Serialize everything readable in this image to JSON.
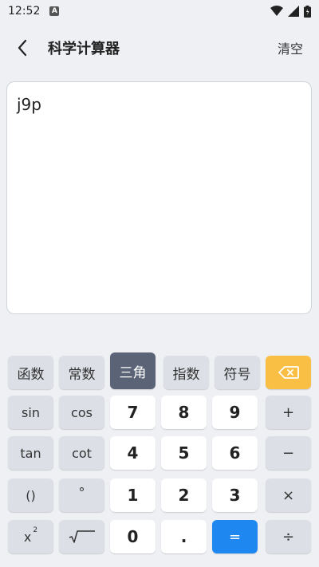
{
  "status": {
    "time": "12:52",
    "a_icon_letter": "A"
  },
  "header": {
    "title": "科学计算器",
    "clear_label": "清空"
  },
  "display": {
    "expression": "j9p"
  },
  "tabs": [
    {
      "label": "函数",
      "active": false
    },
    {
      "label": "常数",
      "active": false
    },
    {
      "label": "三角",
      "active": true
    },
    {
      "label": "指数",
      "active": false
    },
    {
      "label": "符号",
      "active": false
    }
  ],
  "keys": {
    "sin": "sin",
    "cos": "cos",
    "tan": "tan",
    "cot": "cot",
    "paren": "()",
    "degree": "°",
    "square_base": "x",
    "square_exp": "2",
    "n7": "7",
    "n8": "8",
    "n9": "9",
    "n4": "4",
    "n5": "5",
    "n6": "6",
    "n1": "1",
    "n2": "2",
    "n3": "3",
    "n0": "0",
    "dot": ".",
    "equals": "=",
    "plus": "+",
    "minus": "−",
    "times": "×",
    "divide": "÷"
  },
  "colors": {
    "accent": "#1e88f0",
    "backspace": "#f9bf45",
    "active_tab": "#5b6377"
  }
}
